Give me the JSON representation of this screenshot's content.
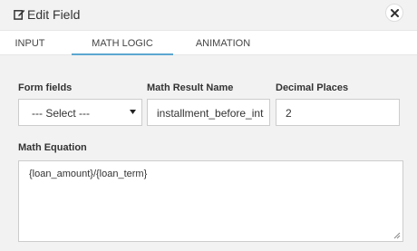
{
  "dialog": {
    "title": "Edit Field"
  },
  "tabs": [
    {
      "label": "INPUT",
      "active": false
    },
    {
      "label": "MATH LOGIC",
      "active": true
    },
    {
      "label": "ANIMATION",
      "active": false
    }
  ],
  "form": {
    "form_fields_label": "Form fields",
    "form_fields_value": "--- Select ---",
    "result_name_label": "Math Result Name",
    "result_name_value": "installment_before_int",
    "decimal_label": "Decimal Places",
    "decimal_value": "2",
    "equation_label": "Math Equation",
    "equation_value": "{loan_amount}/{loan_term}"
  },
  "colors": {
    "active_tab_underline": "#5ba7d1",
    "background": "#f2f2f2"
  },
  "icons": {
    "title": "edit-icon",
    "close": "close-icon",
    "select": "caret-down-icon",
    "textarea": "resize-grip-icon"
  }
}
